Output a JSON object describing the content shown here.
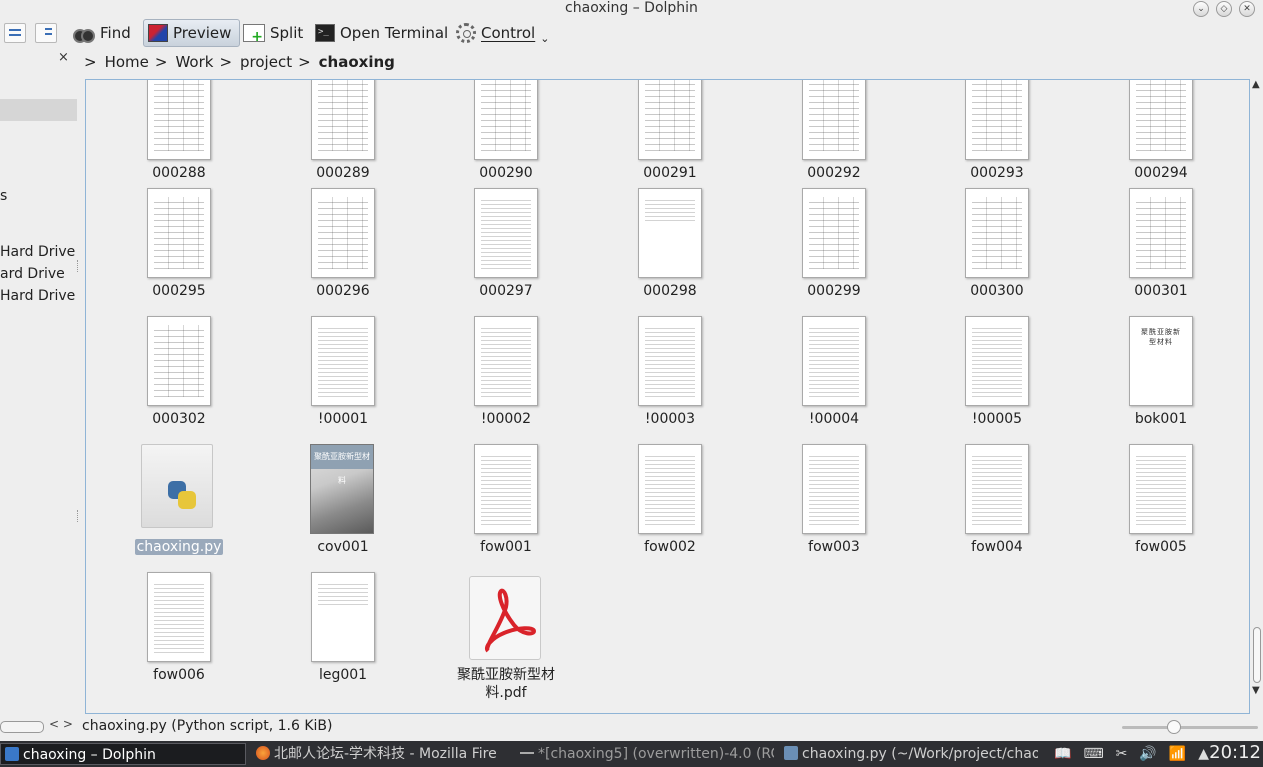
{
  "window": {
    "title": "chaoxing – Dolphin"
  },
  "toolbar": {
    "find": "Find",
    "preview": "Preview",
    "split": "Split",
    "terminal": "Open Terminal",
    "control": "Control"
  },
  "places": {
    "close": "×",
    "partial_s": "s",
    "drive1": "Hard Drive",
    "drive2": "ard Drive",
    "drive3": "Hard Drive"
  },
  "breadcrumb": {
    "sep": ">",
    "items": [
      "Home",
      "Work",
      "project",
      "chaoxing"
    ]
  },
  "files": [
    {
      "name": "000288",
      "kind": "table"
    },
    {
      "name": "000289",
      "kind": "table"
    },
    {
      "name": "000290",
      "kind": "table"
    },
    {
      "name": "000291",
      "kind": "table"
    },
    {
      "name": "000292",
      "kind": "table"
    },
    {
      "name": "000293",
      "kind": "table"
    },
    {
      "name": "000294",
      "kind": "table"
    },
    {
      "name": "000295",
      "kind": "table"
    },
    {
      "name": "000296",
      "kind": "table"
    },
    {
      "name": "000297",
      "kind": "text"
    },
    {
      "name": "000298",
      "kind": "sparse"
    },
    {
      "name": "000299",
      "kind": "table"
    },
    {
      "name": "000300",
      "kind": "table"
    },
    {
      "name": "000301",
      "kind": "table"
    },
    {
      "name": "000302",
      "kind": "table"
    },
    {
      "name": "!00001",
      "kind": "text"
    },
    {
      "name": "!00002",
      "kind": "text"
    },
    {
      "name": "!00003",
      "kind": "text"
    },
    {
      "name": "!00004",
      "kind": "text"
    },
    {
      "name": "!00005",
      "kind": "text"
    },
    {
      "name": "bok001",
      "kind": "cover"
    },
    {
      "name": "chaoxing.py",
      "kind": "python"
    },
    {
      "name": "cov001",
      "kind": "cover-image"
    },
    {
      "name": "fow001",
      "kind": "text"
    },
    {
      "name": "fow002",
      "kind": "text"
    },
    {
      "name": "fow003",
      "kind": "text"
    },
    {
      "name": "fow004",
      "kind": "text"
    },
    {
      "name": "fow005",
      "kind": "text"
    },
    {
      "name": "fow006",
      "kind": "text"
    },
    {
      "name": "leg001",
      "kind": "sparse"
    },
    {
      "name": "聚酰亚胺新型材料.pdf",
      "kind": "pdf"
    }
  ],
  "cover_titles": {
    "bok001": "聚酰亚胺新型材料",
    "cov001": "聚酰亚胺新型材料"
  },
  "status": {
    "text": "chaoxing.py (Python script, 1.6 KiB)",
    "arrows": "< >"
  },
  "taskbar": {
    "tasks": [
      "chaoxing – Dolphin",
      "北邮人论坛-学术科技 - Mozilla Fire",
      "*[chaoxing5] (overwritten)-4.0 (RC",
      "chaoxing.py (~/Work/project/chao"
    ],
    "clock": "20:12"
  },
  "colors": {
    "selection": "#9aa9bb",
    "view_border": "#8fb4d6",
    "taskbar": "#2e2f33"
  }
}
